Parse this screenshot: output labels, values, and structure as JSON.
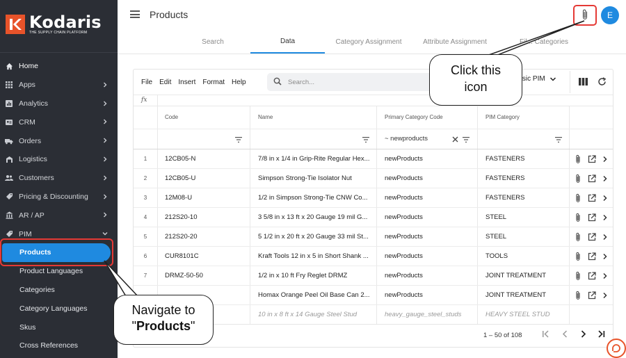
{
  "brand": {
    "name": "Kodaris",
    "tagline": "THE SUPPLY CHAIN PLATFORM",
    "color": "#e8532a"
  },
  "sidebar": {
    "items": [
      {
        "label": "Home",
        "icon": "home-icon"
      },
      {
        "label": "Apps",
        "icon": "apps-icon"
      },
      {
        "label": "Analytics",
        "icon": "analytics-icon"
      },
      {
        "label": "CRM",
        "icon": "crm-icon"
      },
      {
        "label": "Orders",
        "icon": "orders-icon"
      },
      {
        "label": "Logistics",
        "icon": "logistics-icon"
      },
      {
        "label": "Customers",
        "icon": "customers-icon"
      },
      {
        "label": "Pricing & Discounting",
        "icon": "pricing-icon"
      },
      {
        "label": "AR / AP",
        "icon": "bank-icon"
      },
      {
        "label": "PIM",
        "icon": "tag-icon"
      }
    ],
    "pim_subitems": [
      {
        "label": "Products"
      },
      {
        "label": "Product Languages"
      },
      {
        "label": "Categories"
      },
      {
        "label": "Category Languages"
      },
      {
        "label": "Skus"
      },
      {
        "label": "Cross References"
      }
    ]
  },
  "header": {
    "title": "Products",
    "avatar_initial": "E"
  },
  "tabs": [
    {
      "label": "Search"
    },
    {
      "label": "Data"
    },
    {
      "label": "Category Assignment"
    },
    {
      "label": "Attribute Assignment"
    },
    {
      "label": "Fil... Categories"
    }
  ],
  "toolbar": {
    "menu": [
      "File",
      "Edit",
      "Insert",
      "Format",
      "Help"
    ],
    "search_placeholder": "Search...",
    "pim_select": "...asic PIM"
  },
  "formula_bar": {
    "label": "fx"
  },
  "grid": {
    "columns": [
      "Code",
      "Name",
      "Primary Category Code",
      "PIM Category"
    ],
    "filter_value": "~ newproducts",
    "rows": [
      {
        "num": "1",
        "code": "12CB05-N",
        "name": "7/8 in x 1/4 in Grip-Rite Regular Hex...",
        "primary": "newProducts",
        "pim": "FASTENERS"
      },
      {
        "num": "2",
        "code": "12CB05-U",
        "name": "Simpson Strong-Tie Isolator Nut",
        "primary": "newProducts",
        "pim": "FASTENERS"
      },
      {
        "num": "3",
        "code": "12M08-U",
        "name": "1/2 in Simpson Strong-Tie CNW Co...",
        "primary": "newProducts",
        "pim": "FASTENERS"
      },
      {
        "num": "4",
        "code": "212S20-10",
        "name": "3 5/8 in x 13 ft x 20 Gauge 19 mil G...",
        "primary": "newProducts",
        "pim": "STEEL"
      },
      {
        "num": "5",
        "code": "212S20-20",
        "name": "5 1/2 in x 20 ft x 20 Gauge 33 mil St...",
        "primary": "newProducts",
        "pim": "STEEL"
      },
      {
        "num": "6",
        "code": "CUR8101C",
        "name": "Kraft Tools 12 in x 5 in Short Shank ...",
        "primary": "newProducts",
        "pim": "TOOLS"
      },
      {
        "num": "7",
        "code": "DRMZ-50-50",
        "name": "1/2 in x 10 ft Fry Reglet DRMZ",
        "primary": "newProducts",
        "pim": "JOINT TREATMENT"
      },
      {
        "num": "",
        "code": "",
        "name": "Homax Orange Peel Oil Base Can 2...",
        "primary": "newProducts",
        "pim": "JOINT TREATMENT"
      },
      {
        "num": "",
        "code": "",
        "name": "10 in x 8 ft x 14 Gauge Steel Stud",
        "primary": "heavy_gauge_steel_studs",
        "pim": "HEAVY STEEL STUD"
      }
    ]
  },
  "pagination": {
    "text": "1 – 50 of 108"
  },
  "callouts": {
    "click": "Click this icon",
    "click_line1": "Click this",
    "click_line2": "icon",
    "nav_line1": "Navigate to",
    "nav_quote_open": "\"",
    "nav_bold": "Products",
    "nav_quote_close": "\""
  },
  "colors": {
    "accent": "#1f8ae0",
    "highlight": "#e53935",
    "sidebar_bg": "#2b2e35"
  }
}
